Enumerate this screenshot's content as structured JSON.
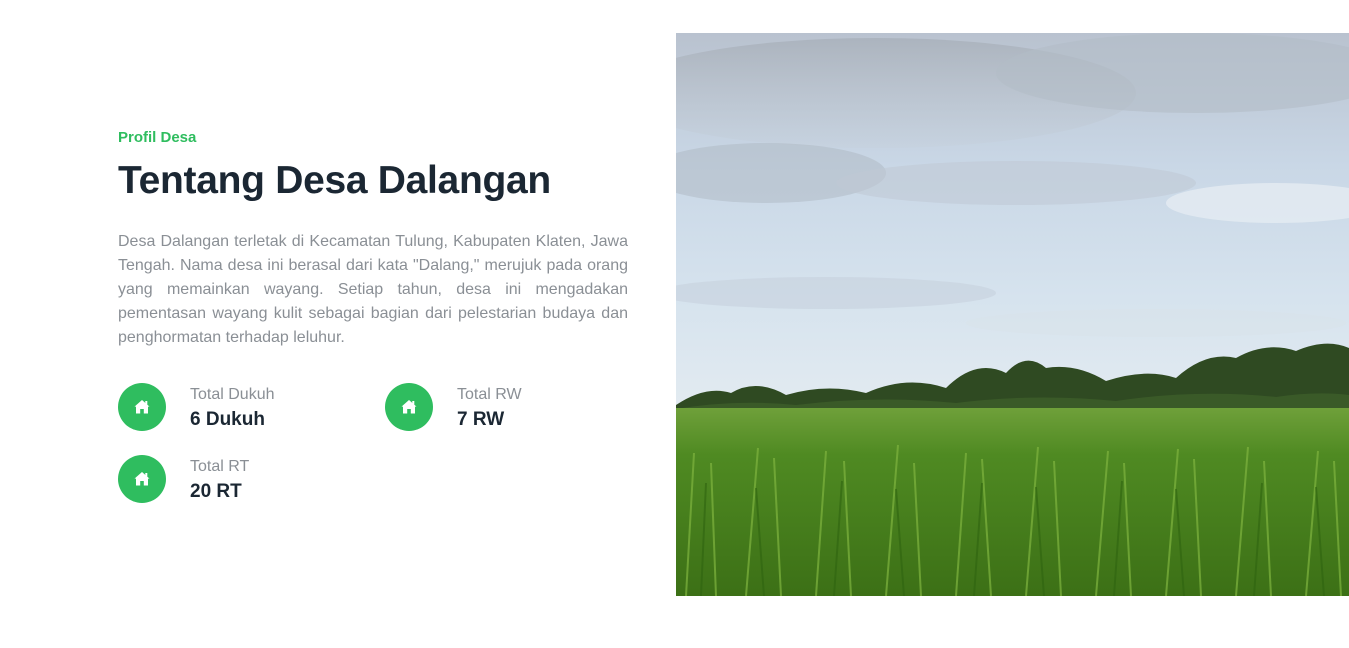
{
  "profile": {
    "eyebrow": "Profil Desa",
    "title": "Tentang Desa Dalangan",
    "description": "Desa Dalangan terletak di Kecamatan Tulung, Kabupaten Klaten, Jawa Tengah. Nama desa ini berasal dari kata \"Dalang,\" merujuk pada orang yang memainkan wayang. Setiap tahun, desa ini mengadakan pementasan wayang kulit sebagai bagian dari pelestarian budaya dan penghormatan terhadap leluhur."
  },
  "stats": [
    {
      "label": "Total Dukuh",
      "value": "6 Dukuh",
      "icon": "home-icon"
    },
    {
      "label": "Total RW",
      "value": "7 RW",
      "icon": "home-icon"
    },
    {
      "label": "Total RT",
      "value": "20 RT",
      "icon": "home-icon"
    }
  ],
  "colors": {
    "accent": "#2fbd5f",
    "heading": "#1b2733",
    "body_text": "#8a8f95"
  },
  "image": {
    "subject": "rice-field-photo"
  }
}
